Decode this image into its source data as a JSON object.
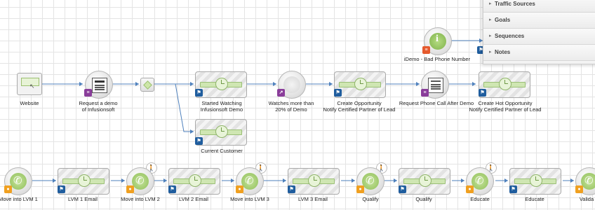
{
  "panel": {
    "items": [
      {
        "label": "Traffic Sources"
      },
      {
        "label": "Goals"
      },
      {
        "label": "Sequences"
      },
      {
        "label": "Notes"
      }
    ]
  },
  "row1": {
    "website": "Website",
    "request_demo": [
      "Request a demo",
      "of Infusionsoft"
    ],
    "started_watching": [
      "Started Watching",
      "Infusionsoft Demo"
    ],
    "watches_more": [
      "Watches more than",
      "20% of Demo"
    ],
    "create_opportunity": [
      "Create Opportunity",
      "Notify Certified Partner of Lead"
    ],
    "request_phone_call": "Request Phone Call After Demo",
    "create_hot_opportunity": [
      "Create Hot Opportunity",
      "Notify Certified Partner of Lead"
    ],
    "current_customer": "Current Customer"
  },
  "top": {
    "idemo_bad_phone": "iDemo - Bad Phone Number"
  },
  "row2": {
    "labels": [
      "Move into LVM 1",
      "LVM 1 Email",
      "Move into LVM 2",
      "LVM 2 Email",
      "Move into LVM 3",
      "LVM 3 Email",
      "Qualify",
      "Qualify",
      "Educate",
      "Educate",
      "Valida"
    ]
  },
  "colors": {
    "flag": "#1f5d9e",
    "person": "#f0a020",
    "form": "#8a3d9a",
    "link": "#4f81bd"
  },
  "icons": [
    "flag-icon",
    "person-icon",
    "form-icon",
    "phone-icon",
    "clock-icon",
    "info-icon",
    "web-icon",
    "contact-card-icon",
    "walking-person-icon"
  ]
}
